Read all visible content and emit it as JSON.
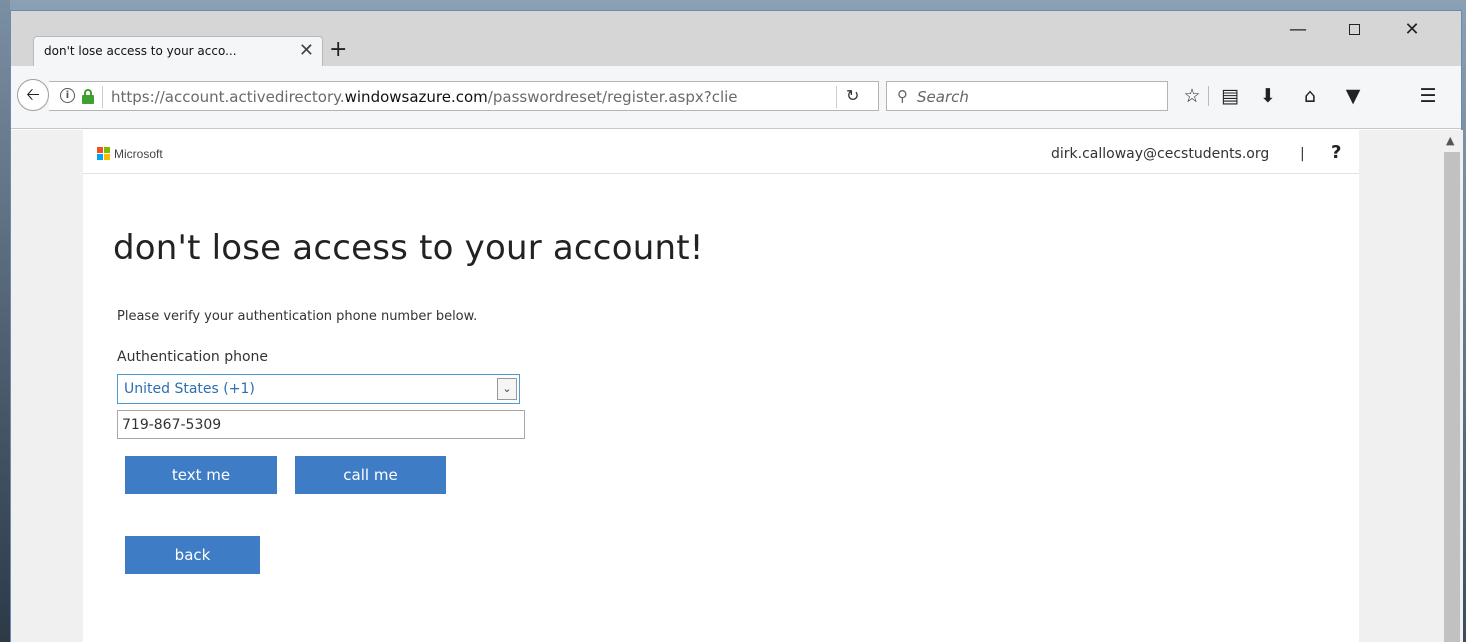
{
  "browser": {
    "tab_title": "don't lose access to your acco...",
    "tab_close": "✕",
    "new_tab": "+",
    "window_min": "—",
    "window_close": "✕",
    "url_prefix": "https://account.activedirectory.",
    "url_domain": "windowsazure.com",
    "url_path": "/passwordreset/register.aspx?clie",
    "search_placeholder": "Search",
    "icons": [
      "info-icon",
      "lock-icon",
      "reload-icon",
      "search-icon",
      "bookmark-star-icon",
      "reading-list-icon",
      "download-icon",
      "home-icon",
      "pocket-icon",
      "menu-icon"
    ]
  },
  "header": {
    "brand": "Microsoft",
    "user_email": "dirk.calloway@cecstudents.org",
    "separator": "|",
    "help": "?"
  },
  "main": {
    "title": "don't lose access to your account!",
    "instruction": "Please verify your authentication phone number below.",
    "auth_label": "Authentication phone",
    "country_selected": "United States (+1)",
    "phone_value": "719-867-5309",
    "text_me_label": "text me",
    "call_me_label": "call me",
    "back_label": "back"
  },
  "colors": {
    "button_blue": "#3e7dc5",
    "select_border": "#4b9bd1",
    "lock_green": "#3fa030"
  }
}
